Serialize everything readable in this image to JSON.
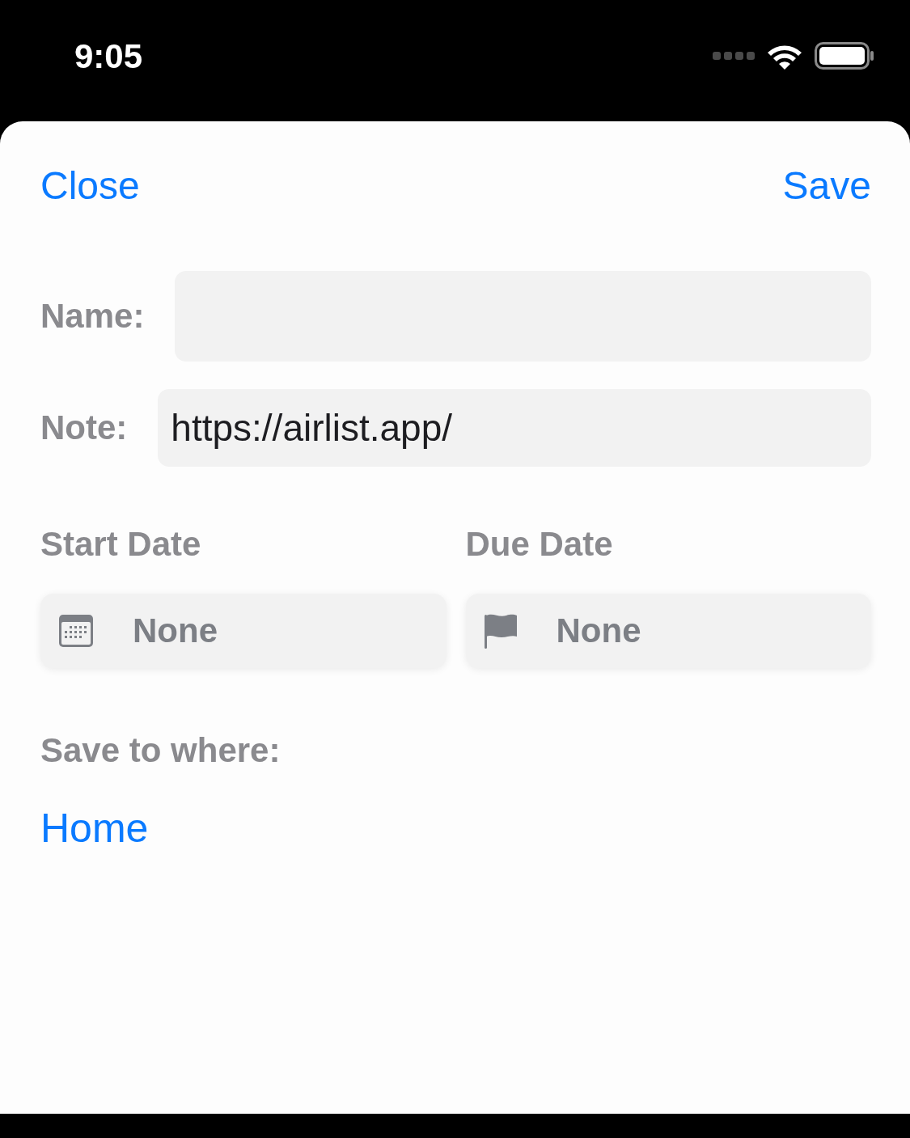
{
  "status_bar": {
    "time": "9:05"
  },
  "header": {
    "close": "Close",
    "save": "Save"
  },
  "fields": [
    {
      "label": "Name:"
    },
    {
      "label": "Note:",
      "value": "https://airlist.app/"
    }
  ],
  "dates": [
    {
      "label": "Start Date",
      "value": "None",
      "kind": "calendar"
    },
    {
      "label": "Due Date",
      "value": "None",
      "kind": "flag"
    }
  ],
  "destination": {
    "label": "Save to where:",
    "value": "Home"
  }
}
